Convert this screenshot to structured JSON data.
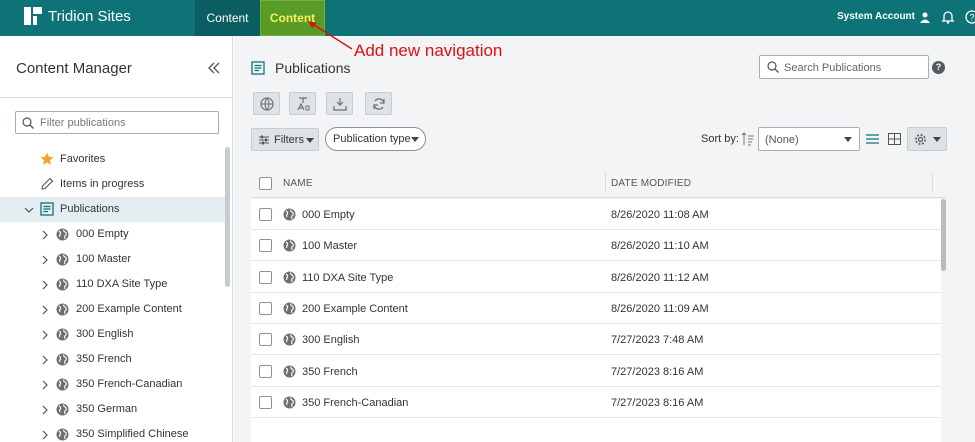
{
  "app": {
    "name": "Tridion Sites",
    "nav_tabs": [
      {
        "label": "Content"
      },
      {
        "label": "Content"
      }
    ],
    "account_label": "System Account"
  },
  "annotation": {
    "text": "Add new navigation",
    "color": "#e01010"
  },
  "sidebar": {
    "title": "Content Manager",
    "filter_placeholder": "Filter publications",
    "tree": [
      {
        "label": "Favorites",
        "icon": "star-icon",
        "level": 0
      },
      {
        "label": "Items in progress",
        "icon": "pencil-icon",
        "level": 0
      },
      {
        "label": "Publications",
        "icon": "publications-icon",
        "level": 0,
        "expanded": true,
        "selected": true
      },
      {
        "label": "000 Empty",
        "icon": "globe-icon",
        "level": 1
      },
      {
        "label": "100 Master",
        "icon": "globe-icon",
        "level": 1
      },
      {
        "label": "110 DXA Site Type",
        "icon": "globe-icon",
        "level": 1
      },
      {
        "label": "200 Example Content",
        "icon": "globe-icon",
        "level": 1
      },
      {
        "label": "300 English",
        "icon": "globe-icon",
        "level": 1
      },
      {
        "label": "350 French",
        "icon": "globe-icon",
        "level": 1
      },
      {
        "label": "350 French-Canadian",
        "icon": "globe-icon",
        "level": 1
      },
      {
        "label": "350 German",
        "icon": "globe-icon",
        "level": 1
      },
      {
        "label": "350 Simplified Chinese",
        "icon": "globe-icon",
        "level": 1
      }
    ]
  },
  "main": {
    "title": "Publications",
    "search_placeholder": "Search Publications",
    "filters_label": "Filters",
    "publication_type_label": "Publication type",
    "sort_by_label": "Sort by:",
    "sort_value": "(None)",
    "columns": {
      "name": "NAME",
      "date": "DATE MODIFIED"
    },
    "rows": [
      {
        "name": "000 Empty",
        "date": "8/26/2020 11:08 AM"
      },
      {
        "name": "100 Master",
        "date": "8/26/2020 11:10 AM"
      },
      {
        "name": "110 DXA Site Type",
        "date": "8/26/2020 11:12 AM"
      },
      {
        "name": "200 Example Content",
        "date": "8/26/2020 11:09 AM"
      },
      {
        "name": "300 English",
        "date": "7/27/2023 7:48 AM"
      },
      {
        "name": "350 French",
        "date": "7/27/2023 8:16 AM"
      },
      {
        "name": "350 French-Canadian",
        "date": "7/27/2023 8:16 AM"
      }
    ]
  },
  "colors": {
    "topbar": "#0e7377",
    "active_tab": "#5a9b28",
    "active_tab_text": "#f3f35a",
    "selected_row": "#e3edf2"
  }
}
